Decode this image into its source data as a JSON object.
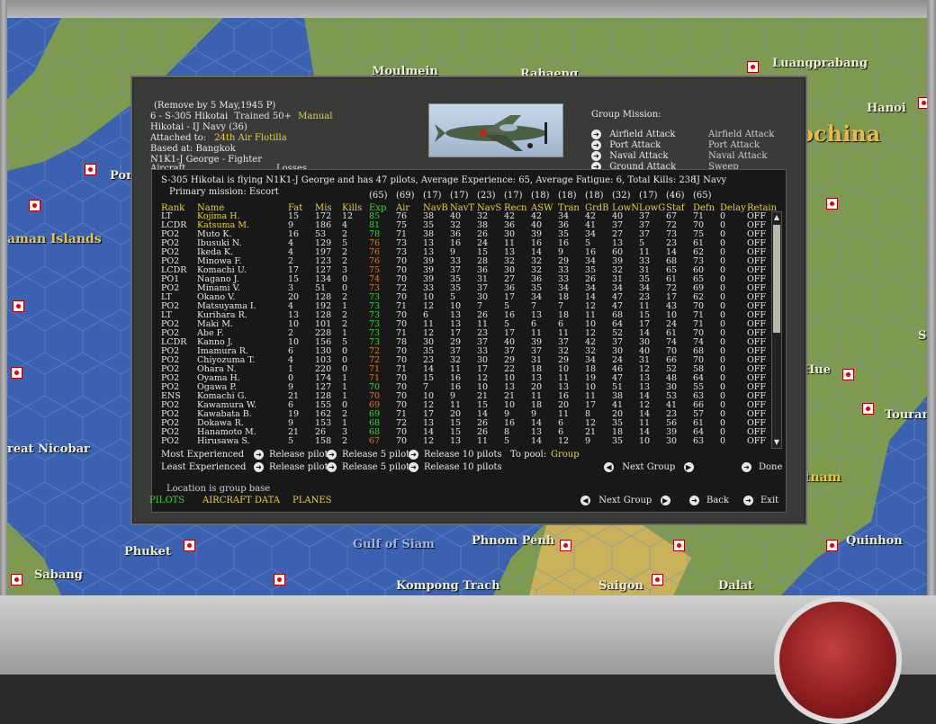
{
  "map": {
    "labels": [
      "Moulmein",
      "Rahaeng",
      "Luangprabang",
      "Hanoi",
      "ochina",
      "Por",
      "aman Islands",
      "reat Nicobar",
      "Phuket",
      "Sabang",
      "Gulf of Siam",
      "Phnom Penh",
      "Kompong Trach",
      "Saigon",
      "Dalat",
      "Quinhon",
      "Tourane",
      "Hue",
      "tnam",
      "Sa"
    ]
  },
  "group": {
    "remove_text": "(Remove by  5 May,1945  P)",
    "name_line": "6 - S-305 Hikotai",
    "trained": "Trained 50+",
    "manual": "Manual",
    "nation_line": "Hikotai - IJ Navy (36)",
    "attached_label": "Attached to:",
    "attached_value": "24th Air Flotilla",
    "based_at": "Based at: Bangkok",
    "aircraft_line": "N1K1-J George - Fighter",
    "aircraft_cut": "Aircraft",
    "losses_cut": "Losses"
  },
  "mission": {
    "title": "Group Mission:",
    "items": [
      {
        "button": "Airfield Attack",
        "value": "Airfield Attack"
      },
      {
        "button": "Port Attack",
        "value": "Port Attack"
      },
      {
        "button": "Naval Attack",
        "value": "Naval Attack"
      },
      {
        "button": "Ground Attack",
        "value": "Sweep"
      }
    ]
  },
  "pilots_panel": {
    "summary": "S-305 Hikotai is flying N1K1-J George and has 47 pilots,  Average Experience: 65,  Average Fatigue: 6,  Total Kills: 238",
    "service": "IJ Navy",
    "primary_mission": "Primary mission: Escort",
    "averages": [
      "(65)",
      "(69)",
      "(17)",
      "(17)",
      "(23)",
      "(17)",
      "(18)",
      "(18)",
      "(18)",
      "(32)",
      "(17)",
      "(46)",
      "(65)"
    ],
    "headers": [
      "Rank",
      "Name",
      "Fat",
      "Mis",
      "Kills",
      "Exp",
      "Air",
      "NavB",
      "NavT",
      "NavS",
      "Recn",
      "ASW",
      "Tran",
      "GrdB",
      "LowN",
      "LowG",
      "Staf",
      "Defn",
      "Delay",
      "Retain"
    ],
    "rows": [
      [
        "LT",
        "Kojima H.",
        "15",
        "172",
        "12",
        "85",
        "76",
        "38",
        "40",
        "32",
        "42",
        "42",
        "34",
        "42",
        "40",
        "37",
        "67",
        "71",
        "0",
        "OFF"
      ],
      [
        "LCDR",
        "Katsuma M.",
        "9",
        "186",
        "4",
        "81",
        "75",
        "35",
        "32",
        "38",
        "36",
        "40",
        "36",
        "41",
        "37",
        "37",
        "72",
        "70",
        "0",
        "OFF"
      ],
      [
        "PO2",
        "Muto K.",
        "16",
        "53",
        "2",
        "78",
        "71",
        "38",
        "36",
        "26",
        "30",
        "39",
        "35",
        "34",
        "27",
        "37",
        "73",
        "75",
        "0",
        "OFF"
      ],
      [
        "PO2",
        "Ibusuki N.",
        "4",
        "129",
        "5",
        "76",
        "73",
        "13",
        "16",
        "24",
        "11",
        "16",
        "16",
        "5",
        "13",
        "5",
        "23",
        "61",
        "0",
        "OFF"
      ],
      [
        "PO2",
        "Ikeda K.",
        "4",
        "197",
        "2",
        "76",
        "73",
        "13",
        "9",
        "15",
        "13",
        "14",
        "9",
        "16",
        "60",
        "11",
        "14",
        "62",
        "0",
        "OFF"
      ],
      [
        "PO2",
        "Minowa F.",
        "2",
        "123",
        "2",
        "76",
        "70",
        "39",
        "33",
        "28",
        "32",
        "32",
        "29",
        "34",
        "39",
        "33",
        "68",
        "73",
        "0",
        "OFF"
      ],
      [
        "LCDR",
        "Komachi U.",
        "17",
        "127",
        "3",
        "75",
        "70",
        "39",
        "37",
        "36",
        "30",
        "32",
        "33",
        "35",
        "32",
        "31",
        "65",
        "60",
        "0",
        "OFF"
      ],
      [
        "PO1",
        "Nagano J.",
        "15",
        "134",
        "0",
        "74",
        "70",
        "39",
        "35",
        "31",
        "27",
        "36",
        "33",
        "26",
        "31",
        "35",
        "61",
        "65",
        "0",
        "OFF"
      ],
      [
        "PO2",
        "Minami V.",
        "3",
        "51",
        "0",
        "73",
        "72",
        "33",
        "35",
        "37",
        "36",
        "35",
        "34",
        "34",
        "34",
        "34",
        "72",
        "69",
        "0",
        "OFF"
      ],
      [
        "LT",
        "Okano V.",
        "20",
        "128",
        "2",
        "73",
        "70",
        "10",
        "5",
        "30",
        "17",
        "34",
        "18",
        "14",
        "47",
        "23",
        "17",
        "62",
        "0",
        "OFF"
      ],
      [
        "PO2",
        "Matsuyama I.",
        "4",
        "192",
        "1",
        "73",
        "71",
        "12",
        "10",
        "7",
        "5",
        "7",
        "7",
        "12",
        "47",
        "11",
        "43",
        "70",
        "0",
        "OFF"
      ],
      [
        "LT",
        "Kurihara R.",
        "13",
        "128",
        "2",
        "73",
        "70",
        "6",
        "13",
        "26",
        "16",
        "13",
        "18",
        "11",
        "68",
        "15",
        "10",
        "71",
        "0",
        "OFF"
      ],
      [
        "PO2",
        "Maki M.",
        "10",
        "101",
        "2",
        "73",
        "70",
        "11",
        "13",
        "11",
        "5",
        "6",
        "6",
        "10",
        "64",
        "17",
        "24",
        "71",
        "0",
        "OFF"
      ],
      [
        "PO2",
        "Abe F.",
        "2",
        "228",
        "1",
        "73",
        "71",
        "12",
        "17",
        "23",
        "17",
        "11",
        "11",
        "12",
        "52",
        "14",
        "61",
        "70",
        "0",
        "OFF"
      ],
      [
        "LCDR",
        "Kanno J.",
        "10",
        "156",
        "5",
        "73",
        "78",
        "30",
        "29",
        "37",
        "40",
        "39",
        "37",
        "42",
        "37",
        "30",
        "74",
        "74",
        "0",
        "OFF"
      ],
      [
        "PO2",
        "Imamura R.",
        "6",
        "130",
        "0",
        "72",
        "70",
        "35",
        "37",
        "33",
        "37",
        "37",
        "32",
        "32",
        "30",
        "40",
        "70",
        "68",
        "0",
        "OFF"
      ],
      [
        "PO2",
        "Chiyozuma T.",
        "4",
        "103",
        "0",
        "72",
        "70",
        "23",
        "32",
        "30",
        "29",
        "31",
        "29",
        "34",
        "24",
        "31",
        "66",
        "70",
        "0",
        "OFF"
      ],
      [
        "PO2",
        "Ohara N.",
        "1",
        "220",
        "0",
        "71",
        "71",
        "14",
        "11",
        "17",
        "22",
        "18",
        "10",
        "18",
        "46",
        "12",
        "52",
        "58",
        "0",
        "OFF"
      ],
      [
        "PO2",
        "Oyama H.",
        "0",
        "174",
        "1",
        "71",
        "70",
        "15",
        "16",
        "12",
        "10",
        "13",
        "11",
        "19",
        "47",
        "13",
        "48",
        "64",
        "0",
        "OFF"
      ],
      [
        "PO2",
        "Ogawa P.",
        "9",
        "127",
        "1",
        "70",
        "70",
        "7",
        "16",
        "10",
        "13",
        "20",
        "13",
        "10",
        "51",
        "13",
        "30",
        "55",
        "0",
        "OFF"
      ],
      [
        "ENS",
        "Komachi G.",
        "21",
        "128",
        "1",
        "70",
        "70",
        "10",
        "9",
        "21",
        "21",
        "11",
        "16",
        "11",
        "38",
        "14",
        "53",
        "63",
        "0",
        "OFF"
      ],
      [
        "PO2",
        "Kawamura W.",
        "6",
        "155",
        "0",
        "69",
        "70",
        "12",
        "11",
        "15",
        "10",
        "18",
        "20",
        "17",
        "41",
        "12",
        "41",
        "66",
        "0",
        "OFF"
      ],
      [
        "PO2",
        "Kawabata B.",
        "19",
        "162",
        "2",
        "69",
        "71",
        "17",
        "20",
        "14",
        "9",
        "9",
        "11",
        "8",
        "20",
        "14",
        "23",
        "57",
        "0",
        "OFF"
      ],
      [
        "PO2",
        "Dokawa R.",
        "9",
        "153",
        "1",
        "68",
        "72",
        "13",
        "15",
        "26",
        "16",
        "14",
        "6",
        "12",
        "35",
        "11",
        "56",
        "61",
        "0",
        "OFF"
      ],
      [
        "PO2",
        "Hanamoto M.",
        "21",
        "26",
        "3",
        "68",
        "70",
        "14",
        "15",
        "26",
        "8",
        "13",
        "6",
        "21",
        "18",
        "14",
        "39",
        "64",
        "0",
        "OFF"
      ],
      [
        "PO2",
        "Hirusawa S.",
        "5",
        "158",
        "2",
        "67",
        "70",
        "12",
        "13",
        "11",
        "5",
        "14",
        "12",
        "9",
        "35",
        "10",
        "30",
        "63",
        "0",
        "OFF"
      ]
    ],
    "exp_colors": [
      "g",
      "g",
      "g",
      "o",
      "o",
      "o",
      "o",
      "o",
      "o",
      "g",
      "g",
      "g",
      "g",
      "g",
      "g",
      "o",
      "o",
      "o",
      "o",
      "g",
      "o",
      "o",
      "g",
      "g",
      "g",
      "o"
    ]
  },
  "release": {
    "most_label": "Most Experienced",
    "least_label": "Least Experienced",
    "release_pilot": "Release pilot",
    "release_5": "Release 5 pilots",
    "release_10": "Release 10 pilots",
    "to_pool_label": "To pool:",
    "to_pool_value": "Group",
    "next_group": "Next Group",
    "done": "Done"
  },
  "footer": {
    "location": "Location is group base",
    "tab_pilots": "PILOTS",
    "tab_aircraft": "AIRCRAFT DATA",
    "tab_planes": "PLANES",
    "next_group": "Next Group",
    "back": "Back",
    "exit": "Exit"
  },
  "colors": {
    "accent_yellow": "#e6d23a",
    "green": "#3fd43f",
    "orange": "#e07a2a",
    "dialog_bg": "#3a3a38"
  }
}
